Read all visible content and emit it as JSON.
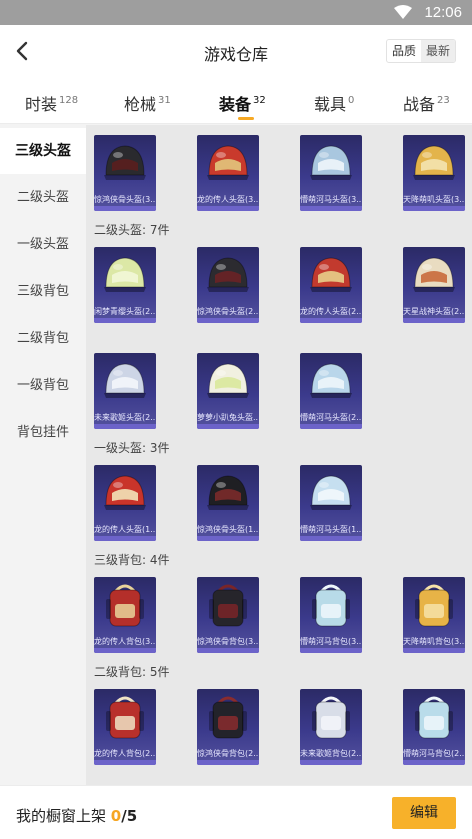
{
  "status_bar": {
    "time": "12:06"
  },
  "header": {
    "title": "游戏仓库",
    "sort_options": [
      "品质",
      "最新"
    ]
  },
  "tabs": [
    {
      "label": "时装",
      "count": "128"
    },
    {
      "label": "枪械",
      "count": "31"
    },
    {
      "label": "装备",
      "count": "32"
    },
    {
      "label": "载具",
      "count": "0"
    },
    {
      "label": "战备",
      "count": "23"
    }
  ],
  "sidebar": [
    "三级头盔",
    "二级头盔",
    "一级头盔",
    "三级背包",
    "二级背包",
    "一级背包",
    "背包挂件"
  ],
  "sections": [
    {
      "heading": "",
      "items": [
        {
          "name": "惊鸿侠骨头盔(3...",
          "icon": "helmet-icon",
          "colors": [
            "#2a2a2e",
            "#5a1e1e"
          ]
        },
        {
          "name": "龙的传人头盔(3...",
          "icon": "helmet-icon",
          "colors": [
            "#c93a2c",
            "#e2c77c"
          ]
        },
        {
          "name": "懵萌河马头盔(3...",
          "icon": "helmet-icon",
          "colors": [
            "#a9c7df",
            "#eef5fb"
          ]
        },
        {
          "name": "天降萌叽头盔(3...",
          "icon": "helmet-icon",
          "colors": [
            "#e3b44b",
            "#f3e3b0"
          ]
        }
      ]
    },
    {
      "heading": "二级头盔: 7件",
      "items": [
        {
          "name": "闲梦青缨头盔(2...",
          "icon": "helmet-icon",
          "colors": [
            "#dce8a6",
            "#f2f7d8"
          ]
        },
        {
          "name": "惊鸿侠骨头盔(2...",
          "icon": "helmet-icon",
          "colors": [
            "#2c2b30",
            "#6a2226"
          ]
        },
        {
          "name": "龙的传人头盔(2...",
          "icon": "helmet-icon",
          "colors": [
            "#c23a2e",
            "#e8cf8a"
          ]
        },
        {
          "name": "天星战神头盔(2...",
          "icon": "helmet-icon",
          "colors": [
            "#e9dcc1",
            "#c96a3b"
          ]
        },
        {
          "name": "未来歌姬头盔(2...",
          "icon": "helmet-icon",
          "colors": [
            "#cdd5e6",
            "#f4f6fb"
          ]
        },
        {
          "name": "萝萝小趴兔头盔...",
          "icon": "helmet-icon",
          "colors": [
            "#f1f0e1",
            "#d9e89c"
          ]
        },
        {
          "name": "懵萌河马头盔(2...",
          "icon": "helmet-icon",
          "colors": [
            "#b9d6ea",
            "#eef6fb"
          ]
        }
      ]
    },
    {
      "heading": "一级头盔: 3件",
      "items": [
        {
          "name": "龙的传人头盔(1...",
          "icon": "helmet-icon",
          "colors": [
            "#c9342a",
            "#f2e3b8"
          ]
        },
        {
          "name": "惊鸿侠骨头盔(1...",
          "icon": "helmet-icon",
          "colors": [
            "#1f1f23",
            "#7a2a2a"
          ]
        },
        {
          "name": "懵萌河马头盔(1...",
          "icon": "helmet-icon",
          "colors": [
            "#c6dff0",
            "#f2f8fc"
          ]
        }
      ]
    },
    {
      "heading": "三级背包: 4件",
      "items": [
        {
          "name": "龙的传人背包(3...",
          "icon": "backpack-icon",
          "colors": [
            "#b42f2a",
            "#e9d39a"
          ]
        },
        {
          "name": "惊鸿侠骨背包(3...",
          "icon": "backpack-icon",
          "colors": [
            "#26252b",
            "#7a2528"
          ]
        },
        {
          "name": "懵萌河马背包(3...",
          "icon": "backpack-icon",
          "colors": [
            "#b8dbe8",
            "#eef7fb"
          ]
        },
        {
          "name": "天降萌叽背包(3...",
          "icon": "backpack-icon",
          "colors": [
            "#e7b347",
            "#f6e2a8"
          ]
        }
      ]
    },
    {
      "heading": "二级背包: 5件",
      "items": [
        {
          "name": "龙的传人背包(2...",
          "icon": "backpack-icon",
          "colors": [
            "#b8302b",
            "#efe2c4"
          ]
        },
        {
          "name": "惊鸿侠骨背包(2...",
          "icon": "backpack-icon",
          "colors": [
            "#23232a",
            "#8a2c2e"
          ]
        },
        {
          "name": "未来歌姬背包(2...",
          "icon": "backpack-icon",
          "colors": [
            "#d8dde8",
            "#f5f6fa"
          ]
        },
        {
          "name": "懵萌河马背包(2...",
          "icon": "backpack-icon",
          "colors": [
            "#b9dcea",
            "#eef7fb"
          ]
        }
      ]
    }
  ],
  "footer": {
    "label": "我的橱窗上架",
    "current": "0",
    "total": "/5",
    "edit_label": "编辑"
  }
}
